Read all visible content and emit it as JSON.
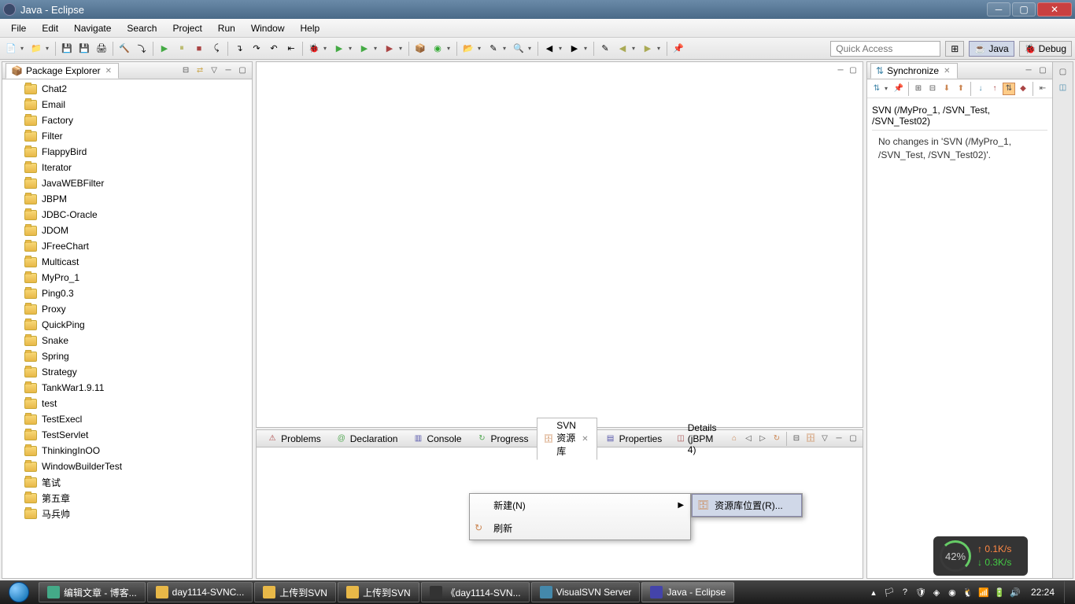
{
  "window": {
    "title": "Java - Eclipse"
  },
  "menubar": [
    "File",
    "Edit",
    "Navigate",
    "Search",
    "Project",
    "Run",
    "Window",
    "Help"
  ],
  "quick_access": {
    "placeholder": "Quick Access"
  },
  "perspectives": {
    "java": "Java",
    "debug": "Debug"
  },
  "package_explorer": {
    "title": "Package Explorer",
    "items": [
      "Chat2",
      "Email",
      "Factory",
      "Filter",
      "FlappyBird",
      "Iterator",
      "JavaWEBFilter",
      "JBPM",
      "JDBC-Oracle",
      "JDOM",
      "JFreeChart",
      "Multicast",
      "MyPro_1",
      "Ping0.3",
      "Proxy",
      "QuickPing",
      "Snake",
      "Spring",
      "Strategy",
      "TankWar1.9.11",
      "test",
      "TestExecl",
      "TestServlet",
      "ThinkingInOO",
      "WindowBuilderTest",
      "笔试",
      "第五章",
      "马兵帅"
    ]
  },
  "synchronize": {
    "title": "Synchronize",
    "subtitle": "SVN (/MyPro_1, /SVN_Test, /SVN_Test02)",
    "message": "No changes in 'SVN (/MyPro_1, /SVN_Test, /SVN_Test02)'."
  },
  "bottom_tabs": {
    "problems": "Problems",
    "declaration": "Declaration",
    "console": "Console",
    "progress": "Progress",
    "svn_repo": "SVN 资源库",
    "properties": "Properties",
    "details": "Details (jBPM 4)"
  },
  "context_menu": {
    "new": "新建(N)",
    "refresh": "刷新",
    "repo_location": "资源库位置(R)..."
  },
  "taskbar": {
    "items": [
      {
        "label": "编辑文章 - 博客...",
        "color": "#4a8"
      },
      {
        "label": "day1114-SVNC...",
        "color": "#e8b848"
      },
      {
        "label": "上传到SVN",
        "color": "#e8b848"
      },
      {
        "label": "上传到SVN",
        "color": "#e8b848"
      },
      {
        "label": "《day1114-SVN...",
        "color": "#333"
      },
      {
        "label": "VisualSVN Server",
        "color": "#48a"
      },
      {
        "label": "Java - Eclipse",
        "color": "#44a"
      }
    ],
    "clock": "22:24"
  },
  "battery": {
    "pct": "42%",
    "up": "0.1K/s",
    "dn": "0.3K/s"
  }
}
